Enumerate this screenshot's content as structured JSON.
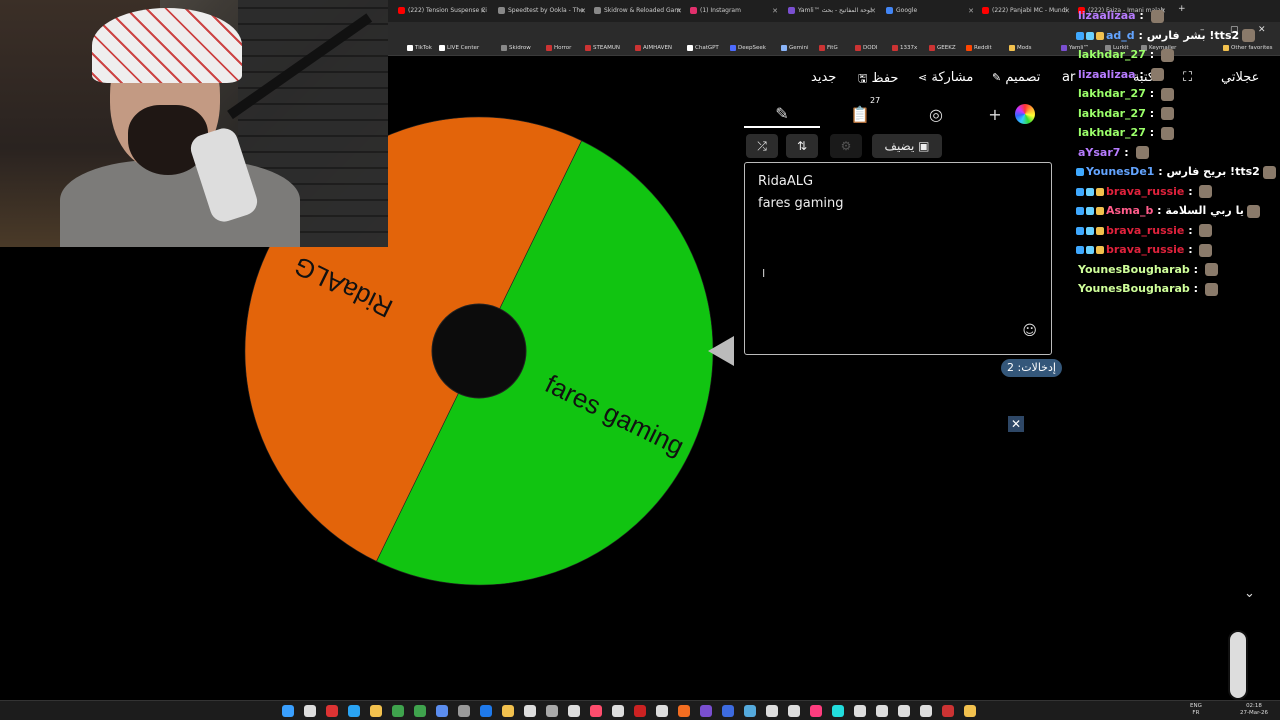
{
  "browser": {
    "tabs": [
      {
        "label": "(222) Tension Suspense Ci",
        "color": "#ff0000"
      },
      {
        "label": "Speedtest by Ookla - The",
        "color": "#888888"
      },
      {
        "label": "Skidrow & Reloaded Gam",
        "color": "#888888"
      },
      {
        "label": "(1) Instagram",
        "color": "#e1306c"
      },
      {
        "label": "Yamli™ لوحة المفاتيح - بحث",
        "color": "#7a4fd0"
      },
      {
        "label": "Google",
        "color": "#4285f4"
      },
      {
        "label": "(222) Panjabi MC - Mundi",
        "color": "#ff0000"
      },
      {
        "label": "(222) Faiza - Imani malah",
        "color": "#ff0000"
      }
    ],
    "bookmarks": [
      {
        "label": "TikTok",
        "color": "#ffffff"
      },
      {
        "label": "LIVE Center",
        "color": "#ffffff"
      },
      {
        "label": "Skidrow",
        "color": "#888888"
      },
      {
        "label": "Horror",
        "color": "#cc3333"
      },
      {
        "label": "STEAMUN",
        "color": "#cc3333"
      },
      {
        "label": "AIMHAVEN",
        "color": "#cc3333"
      },
      {
        "label": "ChatGPT",
        "color": "#ffffff"
      },
      {
        "label": "DeepSeek",
        "color": "#4d6bfe"
      },
      {
        "label": "Gemini",
        "color": "#8ab4f8"
      },
      {
        "label": "FitG",
        "color": "#cc3333"
      },
      {
        "label": "DODI",
        "color": "#cc3333"
      },
      {
        "label": "1337x",
        "color": "#cc3333"
      },
      {
        "label": "GEEKZ",
        "color": "#cc3333"
      },
      {
        "label": "Reddit",
        "color": "#ff4500"
      },
      {
        "label": "Mods",
        "color": "#f2c14e"
      },
      {
        "label": "Yamli™",
        "color": "#7a4fd0"
      },
      {
        "label": "Lurkit",
        "color": "#888888"
      },
      {
        "label": "Keymailer",
        "color": "#888888"
      },
      {
        "label": "Other favorites",
        "color": "#f2c14e"
      }
    ]
  },
  "nav": {
    "new": "جديد",
    "save": "حفظ",
    "share": "مشاركة",
    "design": "تصميم",
    "lang": "ar",
    "gallery": "مكتبة",
    "wheel_title": "عجلاتي"
  },
  "editor": {
    "add_image_label": "يضيف",
    "list_count_badge": "27",
    "entries_text": "RidaALG\nfares gaming",
    "entries_count_label": "إدخالات: 2"
  },
  "wheel": {
    "segments": [
      {
        "label": "fares gaming",
        "color": "#11c411"
      },
      {
        "label": "RidaALG",
        "color": "#e3640a"
      }
    ]
  },
  "chat": [
    {
      "user": "lizaalizaa",
      "text": "",
      "color": "#b77cff",
      "badges": 0
    },
    {
      "user": "ad_d",
      "text": "بشر فارس !tts2",
      "color": "#63a4ff",
      "badges": 3
    },
    {
      "user": "lakhdar_27",
      "text": "",
      "color": "#9bff6a",
      "badges": 0
    },
    {
      "user": "lizaalizaa",
      "text": "",
      "color": "#b77cff",
      "badges": 0
    },
    {
      "user": "lakhdar_27",
      "text": "",
      "color": "#9bff6a",
      "badges": 0
    },
    {
      "user": "lakhdar_27",
      "text": "",
      "color": "#9bff6a",
      "badges": 0
    },
    {
      "user": "lakhdar_27",
      "text": "",
      "color": "#9bff6a",
      "badges": 0
    },
    {
      "user": "aYsar7",
      "text": "",
      "color": "#b77cff",
      "badges": 0
    },
    {
      "user": "YounesDe1",
      "text": "بريح فارس !tts2",
      "color": "#63a4ff",
      "badges": 1
    },
    {
      "user": "brava_russie",
      "text": "",
      "color": "#e0223c",
      "badges": 3
    },
    {
      "user": "Asma_b",
      "text": "يا ربي السلامة",
      "color": "#ff5b8a",
      "badges": 3
    },
    {
      "user": "brava_russie",
      "text": "",
      "color": "#e0223c",
      "badges": 3
    },
    {
      "user": "brava_russie",
      "text": "",
      "color": "#e0223c",
      "badges": 3
    },
    {
      "user": "YounesBougharab",
      "text": "",
      "color": "#cfff9a",
      "badges": 0
    },
    {
      "user": "YounesBougharab",
      "text": "",
      "color": "#cfff9a",
      "badges": 0
    }
  ],
  "tray": {
    "lang1": "ENG",
    "lang2": "FR",
    "time": "02:18",
    "date": "27-Mar-26"
  }
}
